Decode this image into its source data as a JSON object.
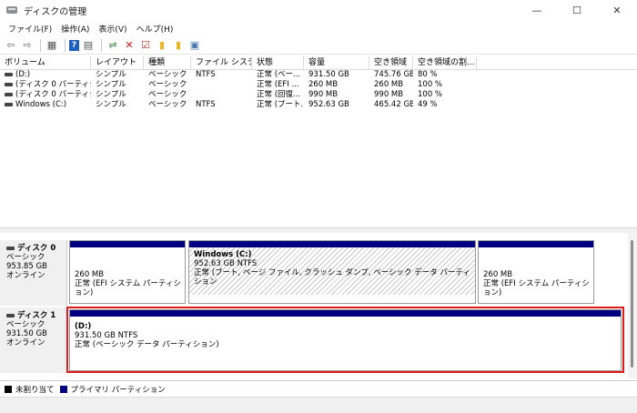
{
  "window": {
    "title": "ディスクの管理",
    "minimize": "—",
    "maximize": "☐",
    "close": "✕"
  },
  "menu": [
    "ファイル(F)",
    "操作(A)",
    "表示(V)",
    "ヘルプ(H)"
  ],
  "toolbar": [
    {
      "icon": "back-arrow-icon",
      "glyph": "⇦",
      "color": "#6b6b6b"
    },
    {
      "icon": "forward-arrow-icon",
      "glyph": "⇨",
      "color": "#6b6b6b"
    },
    {
      "icon": "console-tree-icon",
      "glyph": "▦",
      "color": "#555555"
    },
    {
      "icon": "help-icon",
      "glyph": "?",
      "color": "#1f5fbf"
    },
    {
      "icon": "properties-icon",
      "glyph": "▤",
      "color": "#555555"
    },
    {
      "icon": "connect-icon",
      "glyph": "⇌",
      "color": "#3a7a3a"
    },
    {
      "icon": "delete-icon",
      "glyph": "✕",
      "color": "#d01818"
    },
    {
      "icon": "check-icon",
      "glyph": "☑",
      "color": "#c0392b"
    },
    {
      "icon": "folder-icon",
      "glyph": "▮",
      "color": "#e8b730"
    },
    {
      "icon": "search-folder-icon",
      "glyph": "▮",
      "color": "#e8b730"
    },
    {
      "icon": "window-icon",
      "glyph": "▣",
      "color": "#4a78b0"
    }
  ],
  "volume_list": {
    "headers": [
      "ボリューム",
      "レイアウト",
      "種類",
      "ファイル システム",
      "状態",
      "容量",
      "空き領域",
      "空き領域の割...",
      ""
    ],
    "rows": [
      [
        "(D:)",
        "シンプル",
        "ベーシック",
        "NTFS",
        "正常 (ベー...",
        "931.50 GB",
        "745.76 GB",
        "80 %"
      ],
      [
        "(ディスク 0 パーティシ...",
        "シンプル",
        "ベーシック",
        "",
        "正常 (EFI ...",
        "260 MB",
        "260 MB",
        "100 %"
      ],
      [
        "(ディスク 0 パーティシ...",
        "シンプル",
        "ベーシック",
        "",
        "正常 (回復...",
        "990 MB",
        "990 MB",
        "100 %"
      ],
      [
        "Windows (C:)",
        "シンプル",
        "ベーシック",
        "NTFS",
        "正常 (ブート...",
        "952.63 GB",
        "465.42 GB",
        "49 %"
      ]
    ]
  },
  "disks": [
    {
      "name": "ディスク 0",
      "type": "ベーシック",
      "size": "953.85 GB",
      "status": "オンライン",
      "partitions": [
        {
          "title": "",
          "line1": "260 MB",
          "line2": "正常 (EFI システム パーティション)"
        },
        {
          "title": "Windows  (C:)",
          "line1": "952.63 GB NTFS",
          "line2": "正常 (ブート, ページ ファイル, クラッシュ ダンプ, ベーシック データ パーティション"
        },
        {
          "title": "",
          "line1": "260 MB",
          "line2": "正常 (EFI システム パーティション)"
        }
      ]
    },
    {
      "name": "ディスク 1",
      "type": "ベーシック",
      "size": "931.50 GB",
      "status": "オンライン",
      "partitions": [
        {
          "title": "(D:)",
          "line1": "931.50 GB NTFS",
          "line2": "正常 (ベーシック データ パーティション)"
        }
      ]
    }
  ],
  "legend": [
    {
      "label": "未割り当て",
      "color": "#000000"
    },
    {
      "label": "プライマリ パーティション",
      "color": "#000080"
    }
  ]
}
